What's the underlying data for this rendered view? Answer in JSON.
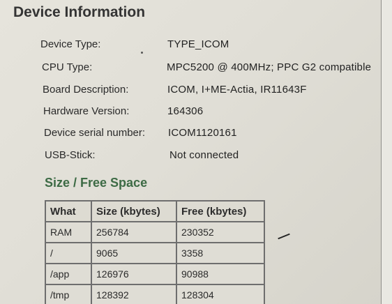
{
  "page": {
    "title": "Device Information"
  },
  "device_info": [
    {
      "label": "Device Type:",
      "value": "TYPE_ICOM"
    },
    {
      "label": "CPU Type:",
      "value": "MPC5200 @ 400MHz; PPC G2 compatible"
    },
    {
      "label": "Board Description:",
      "value": "ICOM, I+ME-Actia, IR11643F"
    },
    {
      "label": "Hardware Version:",
      "value": "164306"
    },
    {
      "label": "Device serial number:",
      "value": "ICOM1120161"
    },
    {
      "label": "USB-Stick:",
      "value": "Not connected"
    }
  ],
  "space": {
    "title": "Size / Free Space",
    "headers": [
      "What",
      "Size (kbytes)",
      "Free (kbytes)"
    ],
    "rows": [
      [
        "RAM",
        "256784",
        "230352"
      ],
      [
        "/",
        "9065",
        "3358"
      ],
      [
        "/app",
        "126976",
        "90988"
      ],
      [
        "/tmp",
        "128392",
        "128304"
      ]
    ]
  },
  "colors": {
    "section_title": "#3d6b45",
    "background": "#e1dfd7",
    "table_border": "#6e6e6e"
  }
}
